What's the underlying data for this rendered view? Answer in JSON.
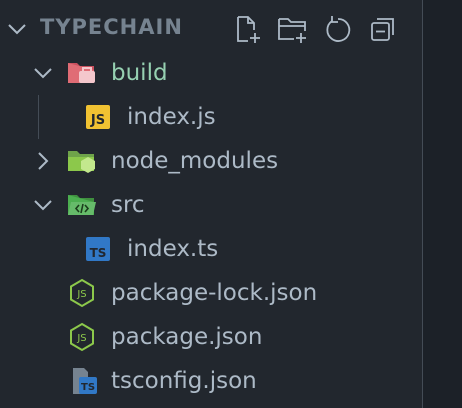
{
  "explorer": {
    "title": "TYPECHAIN",
    "actions": [
      {
        "name": "new-file-icon"
      },
      {
        "name": "new-folder-icon"
      },
      {
        "name": "refresh-icon"
      },
      {
        "name": "collapse-all-icon"
      }
    ]
  },
  "tree": [
    {
      "label": "build",
      "kind": "folder-open",
      "icon": "build-folder-icon"
    },
    {
      "label": "index.js",
      "kind": "file",
      "icon": "javascript-file-icon",
      "badge": "JS"
    },
    {
      "label": "node_modules",
      "kind": "folder-closed",
      "icon": "node-modules-folder-icon"
    },
    {
      "label": "src",
      "kind": "folder-open",
      "icon": "src-folder-icon"
    },
    {
      "label": "index.ts",
      "kind": "file",
      "icon": "typescript-file-icon",
      "badge": "TS"
    },
    {
      "label": "package-lock.json",
      "kind": "file",
      "icon": "nodejs-file-icon"
    },
    {
      "label": "package.json",
      "kind": "file",
      "icon": "nodejs-file-icon"
    },
    {
      "label": "tsconfig.json",
      "kind": "file",
      "icon": "tsconfig-file-icon",
      "badge": "TS"
    }
  ],
  "colors": {
    "background": "#22272e",
    "text": "#adbac7",
    "build_label": "#96d0b1",
    "js_badge": "#f1c232",
    "ts_badge": "#3178c6",
    "node_green": "#8cc84b"
  }
}
